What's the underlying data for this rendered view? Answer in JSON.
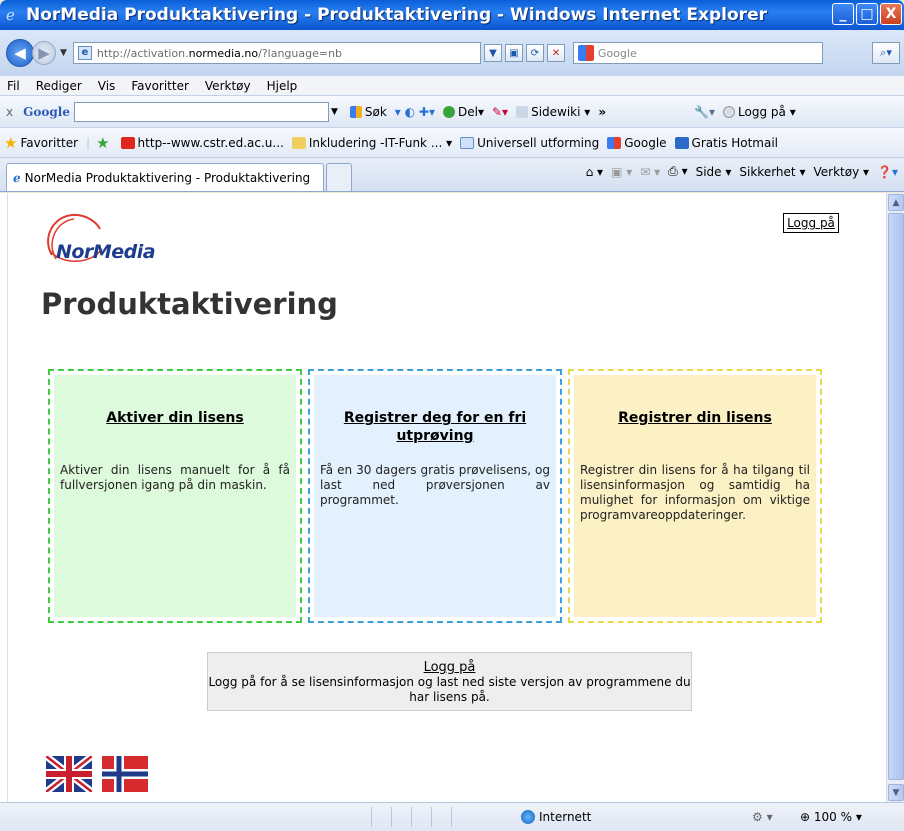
{
  "window": {
    "title": "NorMedia Produktaktivering - Produktaktivering - Windows Internet Explorer",
    "minimize_glyph": "_",
    "maximize_glyph": "□",
    "close_glyph": "X"
  },
  "address_bar": {
    "url_prefix": "http://activation.",
    "url_host": "normedia.no",
    "url_suffix": "/?language=nb",
    "search_placeholder": "Google"
  },
  "menu": {
    "items": [
      "Fil",
      "Rediger",
      "Vis",
      "Favoritter",
      "Verktøy",
      "Hjelp"
    ]
  },
  "google_toolbar": {
    "close": "x",
    "logo": "Google",
    "search_label": "Søk",
    "share_label": "Del",
    "sidewiki_label": "Sidewiki",
    "more": "»",
    "login_label": "Logg på"
  },
  "favorites": {
    "label": "Favoritter",
    "items": [
      "http--www.cstr.ed.ac.u...",
      "Inkludering -IT-Funk ...",
      "Universell utforming",
      "Google",
      "Gratis Hotmail"
    ]
  },
  "tabs": {
    "active_tab": "NorMedia Produktaktivering - Produktaktivering",
    "commands": [
      "Side",
      "Sikkerhet",
      "Verktøy"
    ]
  },
  "page": {
    "logo_text": "NorMedia",
    "login_top": "Logg på",
    "title": "Produktaktivering",
    "cards": [
      {
        "heading": "Aktiver din lisens",
        "text": "Aktiver din lisens manuelt for å få fullversjonen igang på din maskin."
      },
      {
        "heading": "Registrer deg for en fri utprøving",
        "text": "Få en 30 dagers gratis prøvelisens, og last ned prøversjonen av programmet."
      },
      {
        "heading": "Registrer din lisens",
        "text": "Registrer din lisens for å ha tilgang til lisensinformasjon og samtidig ha mulighet for informasjon om viktige programvareoppdateringer."
      }
    ],
    "login_box": {
      "link": "Logg på",
      "text": "Logg på for å se lisensinformasjon og last ned siste versjon av programmene du har lisens på."
    }
  },
  "status_bar": {
    "zone": "Internett",
    "zoom": "100 %"
  },
  "colors": {
    "title_bar": "#0a5fd8",
    "card_green": "#ddfadc",
    "card_blue": "#e2f1fd",
    "card_yellow": "#fcf0c5",
    "page_title": "#333333",
    "logo_blue": "#1f3d8f",
    "logo_red": "#e23a2e"
  }
}
